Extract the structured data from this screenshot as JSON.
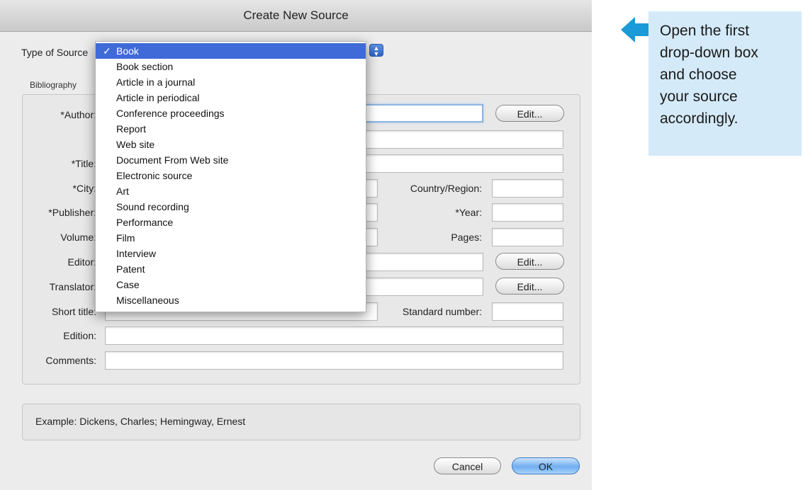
{
  "dialog": {
    "title": "Create New Source",
    "type_label": "Type of Source",
    "bibliography_label": "Bibliography",
    "fields": {
      "author": "*Author:",
      "title": "*Title:",
      "city": "*City:",
      "country": "Country/Region:",
      "publisher": "*Publisher:",
      "year": "*Year:",
      "volume": "Volume:",
      "pages": "Pages:",
      "editor": "Editor:",
      "translator": "Translator:",
      "short_title": "Short title:",
      "standard_number": "Standard number:",
      "edition": "Edition:",
      "comments": "Comments:"
    },
    "edit_label": "Edit...",
    "example_text": "Example: Dickens, Charles; Hemingway, Ernest",
    "cancel_label": "Cancel",
    "ok_label": "OK"
  },
  "dropdown": {
    "check": "✓",
    "items": [
      "Book",
      "Book section",
      "Article in a journal",
      "Article in periodical",
      "Conference proceedings",
      "Report",
      "Web site",
      "Document From Web site",
      "Electronic source",
      "Art",
      "Sound recording",
      "Performance",
      "Film",
      "Interview",
      "Patent",
      "Case",
      "Miscellaneous"
    ],
    "selected": "Book"
  },
  "callout": {
    "lines": [
      "Open the first",
      "drop-down box",
      "and choose",
      "your source",
      "accordingly."
    ],
    "arrow_color": "#1a9ad6",
    "background": "#d4eaf8"
  },
  "colors": {
    "accent": "#3f6ad8"
  }
}
